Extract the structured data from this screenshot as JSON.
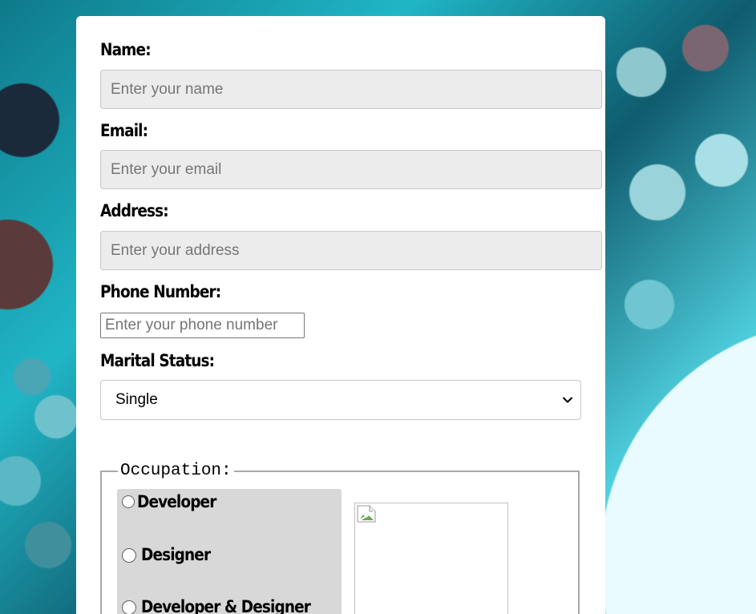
{
  "form": {
    "name": {
      "label": "Name:",
      "placeholder": "Enter your name"
    },
    "email": {
      "label": "Email:",
      "placeholder": "Enter your email"
    },
    "address": {
      "label": "Address:",
      "placeholder": "Enter your address"
    },
    "phone": {
      "label": "Phone Number:",
      "placeholder": "Enter your phone number"
    },
    "marital": {
      "label": "Marital Status:",
      "selected": "Single"
    },
    "occupation": {
      "legend": "Occupation:",
      "options": [
        "Developer",
        "Designer",
        "Developer & Designer"
      ]
    }
  },
  "icons": {
    "select": "chevron-down-icon",
    "image": "broken-image-icon"
  }
}
